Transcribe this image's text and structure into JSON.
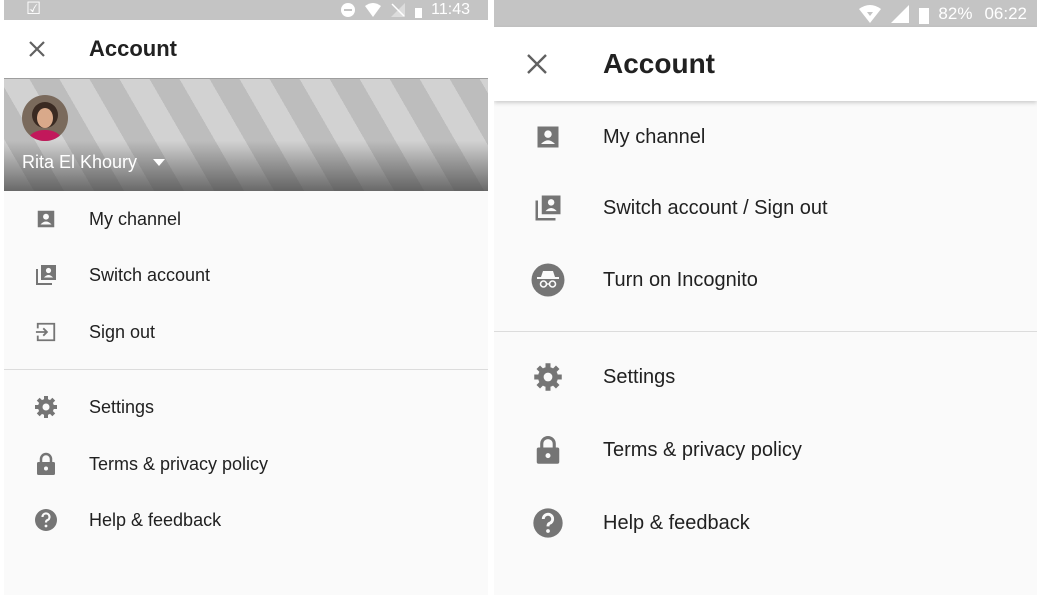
{
  "colors": {
    "icon": "#757575",
    "status_bar": "#c4c4c4",
    "text": "#212121"
  },
  "left": {
    "status_bar": {
      "time": "11:43"
    },
    "app_bar": {
      "title": "Account",
      "close_icon": "close-icon"
    },
    "account": {
      "name": "Rita El Khoury"
    },
    "menu": [
      {
        "label": "My channel",
        "icon": "account-box-icon"
      },
      {
        "label": "Switch account",
        "icon": "switch-account-icon"
      },
      {
        "label": "Sign out",
        "icon": "exit-icon"
      },
      {
        "label": "Settings",
        "icon": "gear-icon"
      },
      {
        "label": "Terms & privacy policy",
        "icon": "lock-icon"
      },
      {
        "label": "Help & feedback",
        "icon": "help-icon"
      }
    ]
  },
  "right": {
    "status_bar": {
      "battery": "82%",
      "time": "06:22"
    },
    "app_bar": {
      "title": "Account",
      "close_icon": "close-icon"
    },
    "menu": [
      {
        "label": "My channel",
        "icon": "account-box-icon"
      },
      {
        "label": "Switch account / Sign out",
        "icon": "switch-account-icon"
      },
      {
        "label": "Turn on Incognito",
        "icon": "incognito-icon"
      },
      {
        "label": "Settings",
        "icon": "gear-icon"
      },
      {
        "label": "Terms & privacy policy",
        "icon": "lock-icon"
      },
      {
        "label": "Help & feedback",
        "icon": "help-icon"
      }
    ]
  }
}
